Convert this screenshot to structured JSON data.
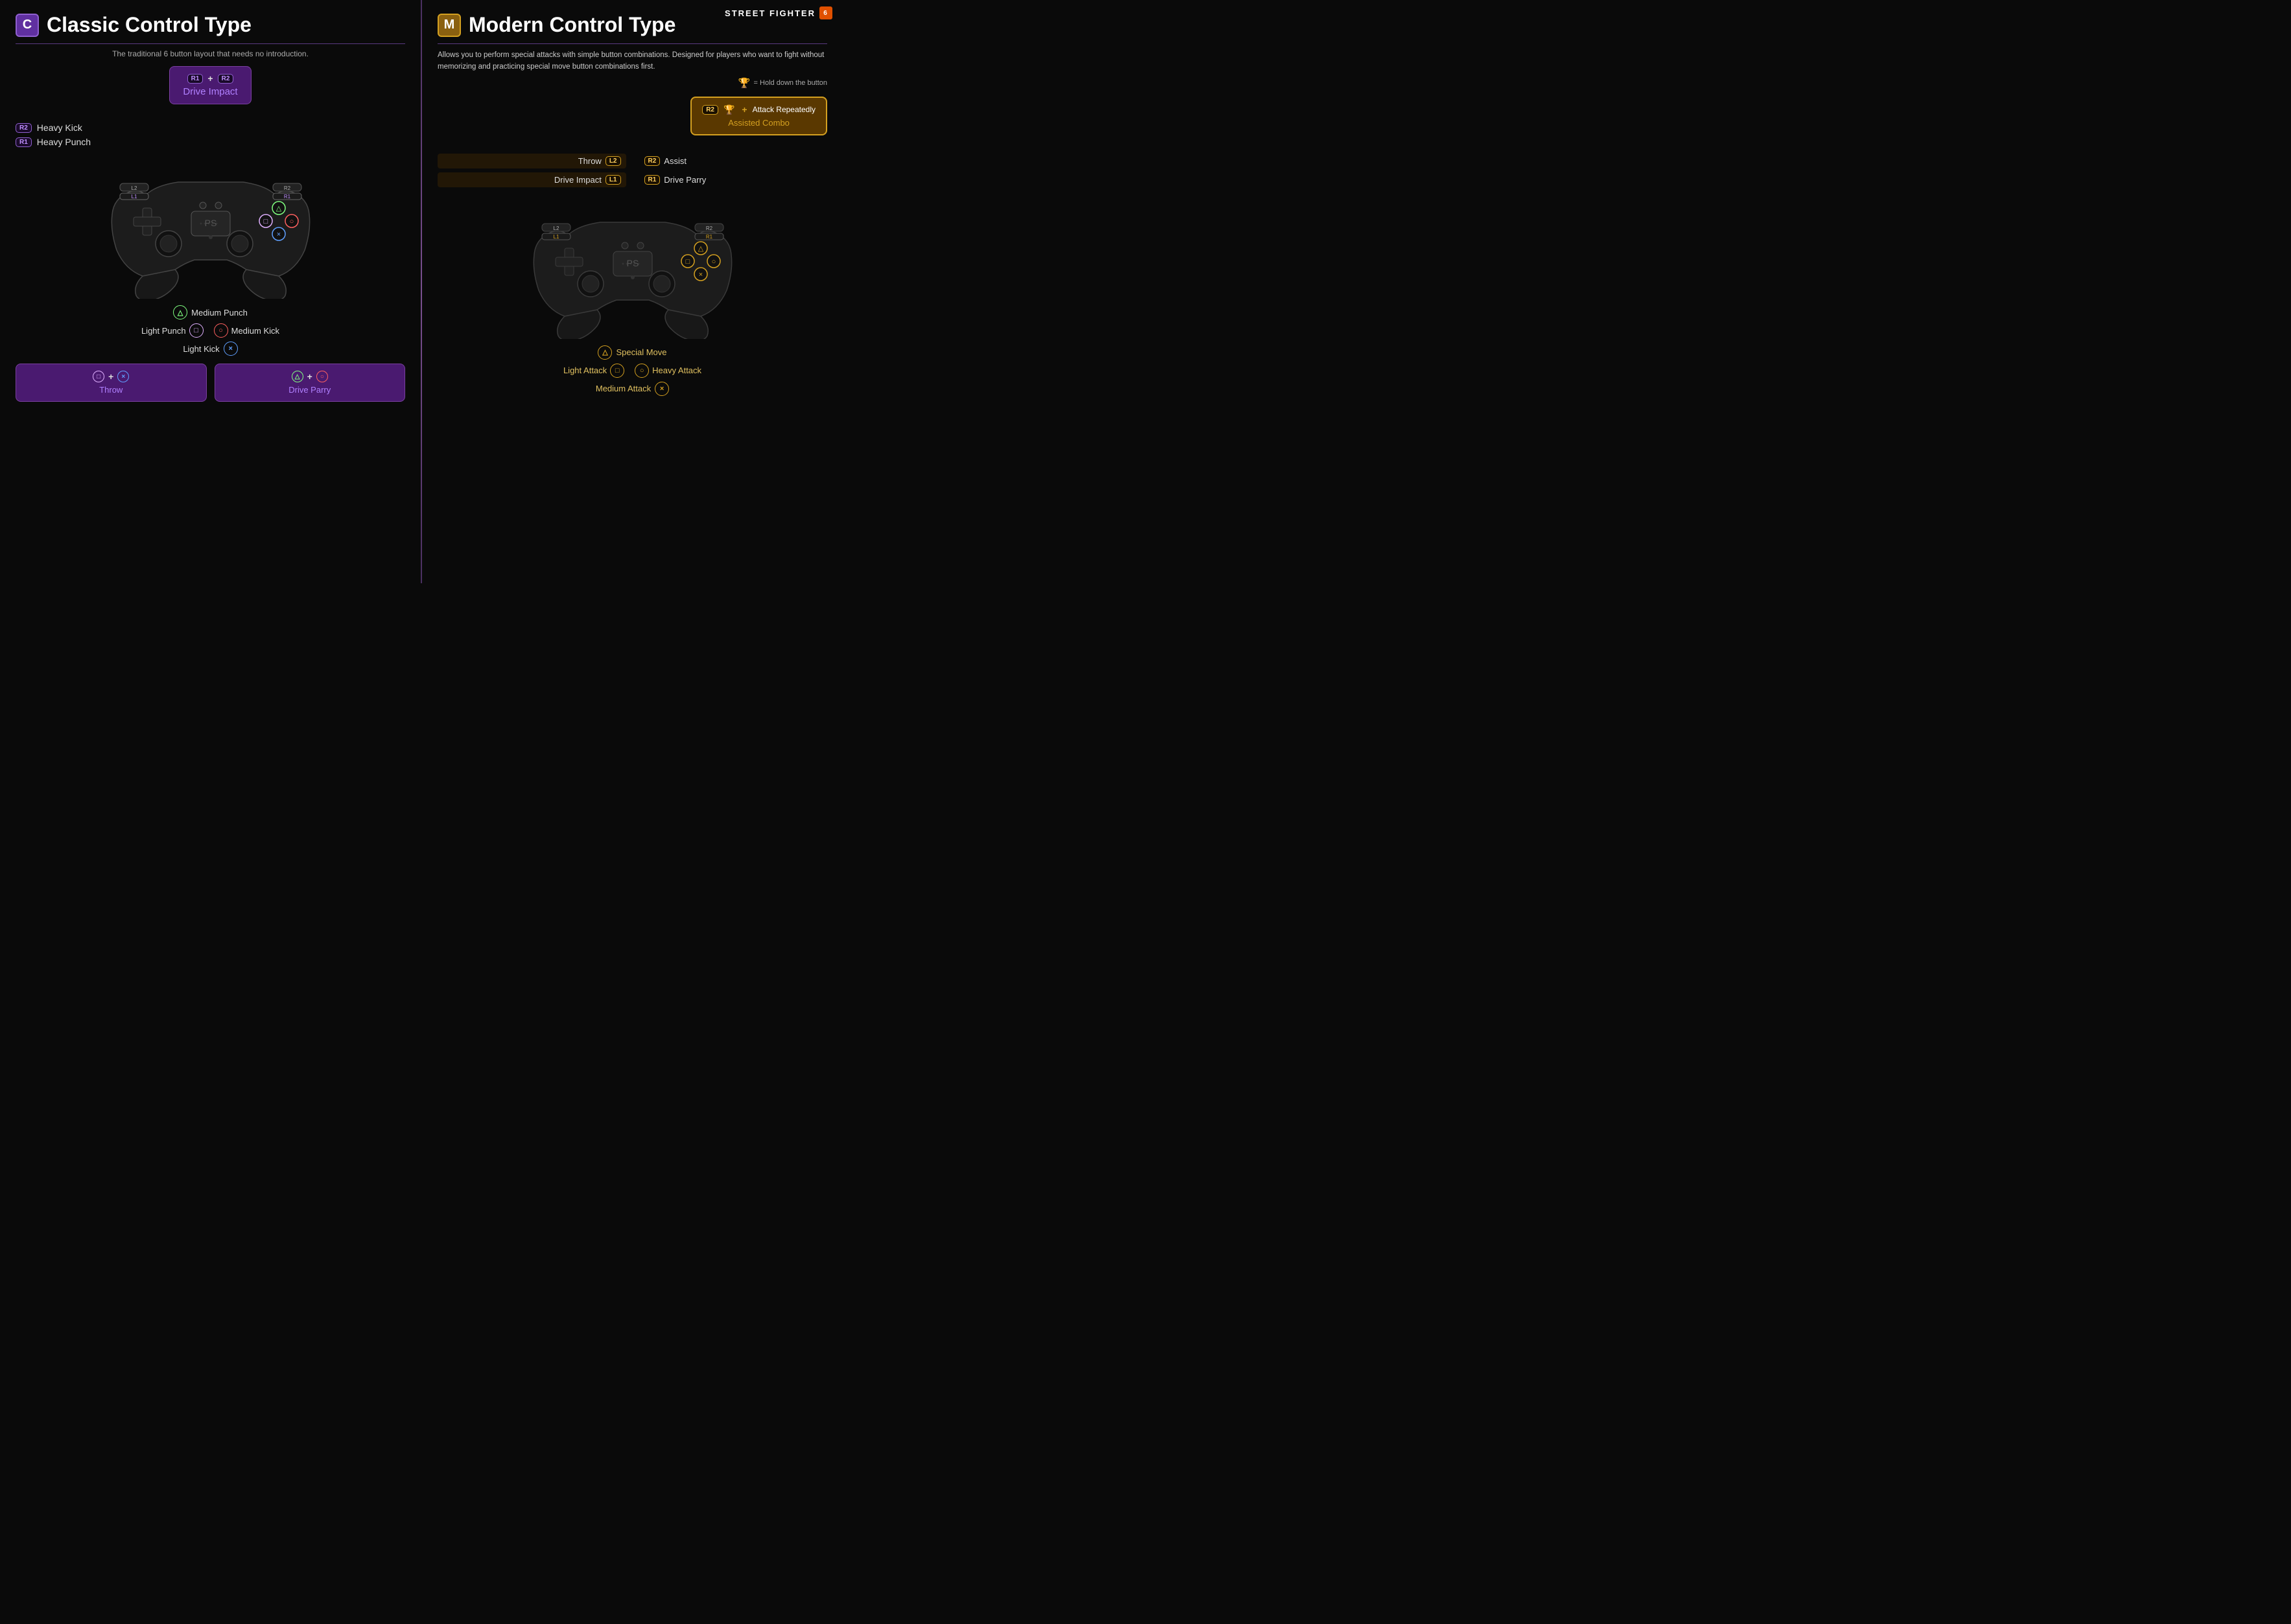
{
  "brand": {
    "name": "STREET FIGHTER",
    "icon": "6"
  },
  "classic": {
    "badge": "C",
    "title": "Classic Control Type",
    "subtitle": "The traditional 6 button layout that needs no introduction.",
    "drive_impact": {
      "keys": [
        "R1",
        "+",
        "R2"
      ],
      "label": "Drive Impact"
    },
    "shoulder": [
      {
        "key": "R2",
        "action": "Heavy Kick"
      },
      {
        "key": "R1",
        "action": "Heavy Punch"
      }
    ],
    "face_buttons": {
      "triangle": {
        "label": "Medium Punch",
        "symbol": "△"
      },
      "square": {
        "label": "Light Punch",
        "symbol": "□"
      },
      "circle": {
        "label": "Medium Kick",
        "symbol": "○"
      },
      "cross": {
        "label": "Light Kick",
        "symbol": "×"
      }
    },
    "combos": [
      {
        "keys": [
          "□",
          "+",
          "×"
        ],
        "label": "Throw"
      },
      {
        "keys": [
          "△",
          "+",
          "○"
        ],
        "label": "Drive Parry"
      }
    ]
  },
  "modern": {
    "badge": "M",
    "title": "Modern Control Type",
    "subtitle": "Allows you to perform special attacks with simple button combinations. Designed for players who want to fight without memorizing and practicing special move button combinations first.",
    "hold_note": "= Hold down the button",
    "assisted_combo": {
      "keys": [
        "R2",
        "🏆",
        "+",
        "Attack Repeatedly"
      ],
      "label": "Assisted Combo"
    },
    "shoulder_left": [
      {
        "side": "left",
        "action": "Throw",
        "key": "L2"
      },
      {
        "side": "left",
        "action": "Drive Impact",
        "key": "L1"
      }
    ],
    "shoulder_right": [
      {
        "side": "right",
        "key": "R2",
        "action": "Assist"
      },
      {
        "side": "right",
        "key": "R1",
        "action": "Drive Parry"
      }
    ],
    "face_buttons": {
      "triangle": {
        "label": "Special Move",
        "symbol": "△"
      },
      "square": {
        "label": "Light Attack",
        "symbol": "□"
      },
      "circle": {
        "label": "Heavy Attack",
        "symbol": "○"
      },
      "cross": {
        "label": "Medium Attack",
        "symbol": "×"
      }
    }
  }
}
